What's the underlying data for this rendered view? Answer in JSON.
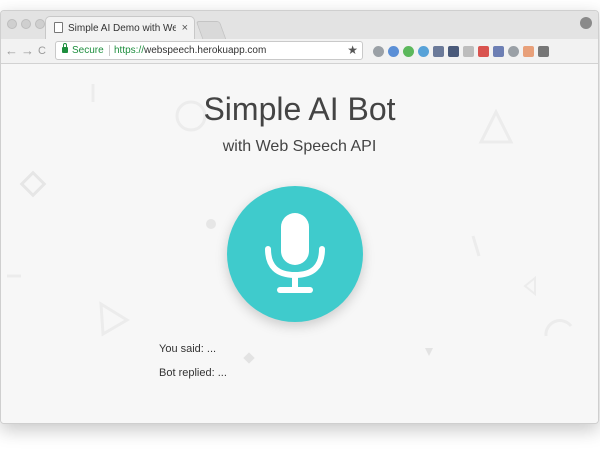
{
  "browser": {
    "tab_title": "Simple AI Demo with Web Spe",
    "tab_close": "×",
    "nav": {
      "back": "←",
      "forward": "→",
      "reload": "C"
    },
    "address": {
      "secure_label": "Secure",
      "url_scheme": "https://",
      "url_host": "webspeech.herokuapp.com",
      "bookmark_icon": "★"
    },
    "extensions": [
      {
        "name": "info-icon",
        "color": "#9aa0a6"
      },
      {
        "name": "extension-blue-icon",
        "color": "#5b8fd6"
      },
      {
        "name": "extension-green-icon",
        "color": "#5cb85c"
      },
      {
        "name": "extension-teal-icon",
        "color": "#57a2d8"
      },
      {
        "name": "extension-image-icon",
        "color": "#6b7a99"
      },
      {
        "name": "extension-n-icon",
        "color": "#4a5a7a"
      },
      {
        "name": "extension-r-icon",
        "color": "#bdbdbd"
      },
      {
        "name": "extension-red-icon",
        "color": "#d9534f"
      },
      {
        "name": "extension-w-icon",
        "color": "#6d7fb4"
      },
      {
        "name": "cast-icon",
        "color": "#9aa0a6"
      },
      {
        "name": "extension-orange-icon",
        "color": "#e8a07a"
      },
      {
        "name": "menu-icon",
        "color": "#777777"
      }
    ]
  },
  "page": {
    "title": "Simple AI Bot",
    "subtitle": "with Web Speech API",
    "mic_color": "#3fcbcc",
    "you_said": "You said: ...",
    "bot_replied": "Bot replied: ..."
  }
}
